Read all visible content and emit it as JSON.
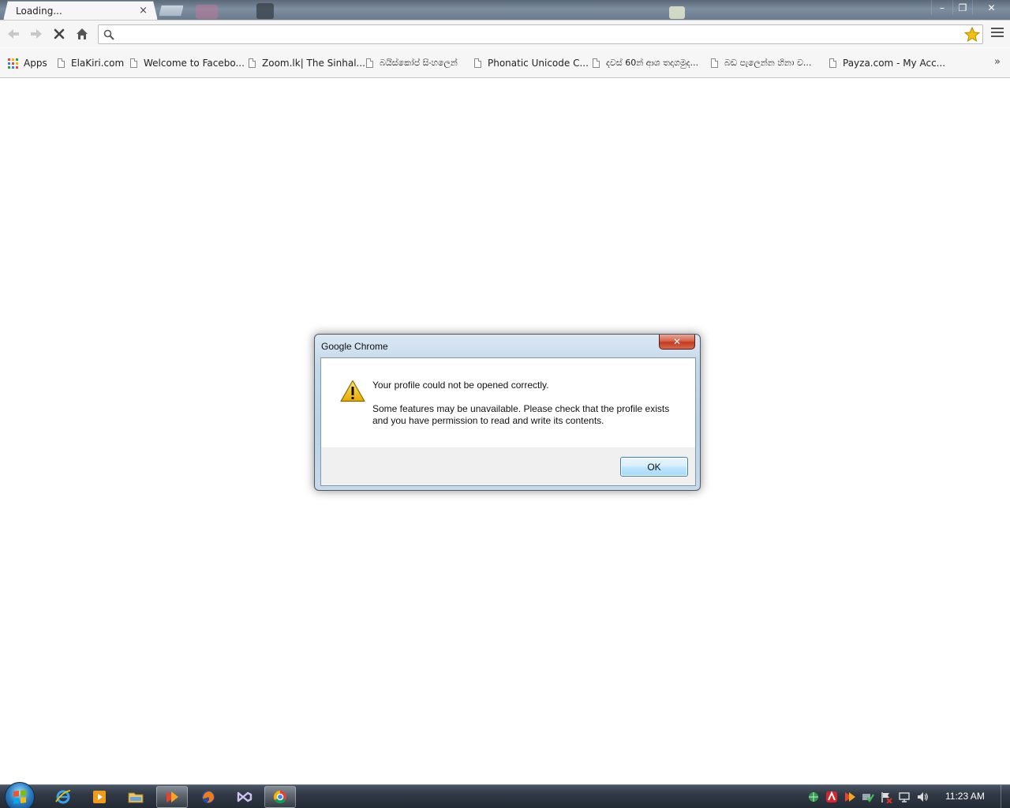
{
  "browser": {
    "tab": {
      "title": "Loading...",
      "close_glyph": "×"
    },
    "window_controls": {
      "minimize": "–",
      "maximize": "❐",
      "close": "✕"
    },
    "toolbar": {
      "omnibox_value": "",
      "icons": [
        "back-icon",
        "forward-icon",
        "stop-icon",
        "home-icon",
        "search-icon",
        "star-icon",
        "menu-icon"
      ]
    },
    "bookmarks": {
      "apps_label": "Apps",
      "items": [
        "ElaKiri.com",
        "Welcome to Facebo...",
        "Zoom.lk| The Sinhal...",
        "බයිස්කෝප් සිංහලෙන්",
        "Phonatic Unicode C...",
        "දවස් 60න් ආශ තදාගමුද...",
        "බඩ පැලෙන්න හිනා ව...",
        "Payza.com - My Acc..."
      ],
      "overflow_glyph": "»"
    }
  },
  "dialog": {
    "title": "Google Chrome",
    "close_glyph": "✕",
    "message": "Your profile could not be opened correctly.",
    "detail_line1": "Some features may be unavailable.  Please check that the profile exists",
    "detail_line2": "and you have permission to read and write its contents.",
    "ok_label": "OK"
  },
  "taskbar": {
    "apps": [
      "internet-explorer-icon",
      "media-player-icon",
      "file-explorer-icon",
      "pdf-reader-icon",
      "firefox-icon",
      "visual-studio-icon",
      "chrome-icon"
    ],
    "active_app": "chrome-icon",
    "clock": "11:23 AM"
  },
  "colors": {
    "accent_blue": "#3c7fb1",
    "close_red": "#c43a20",
    "warning_yellow": "#f5c400"
  }
}
